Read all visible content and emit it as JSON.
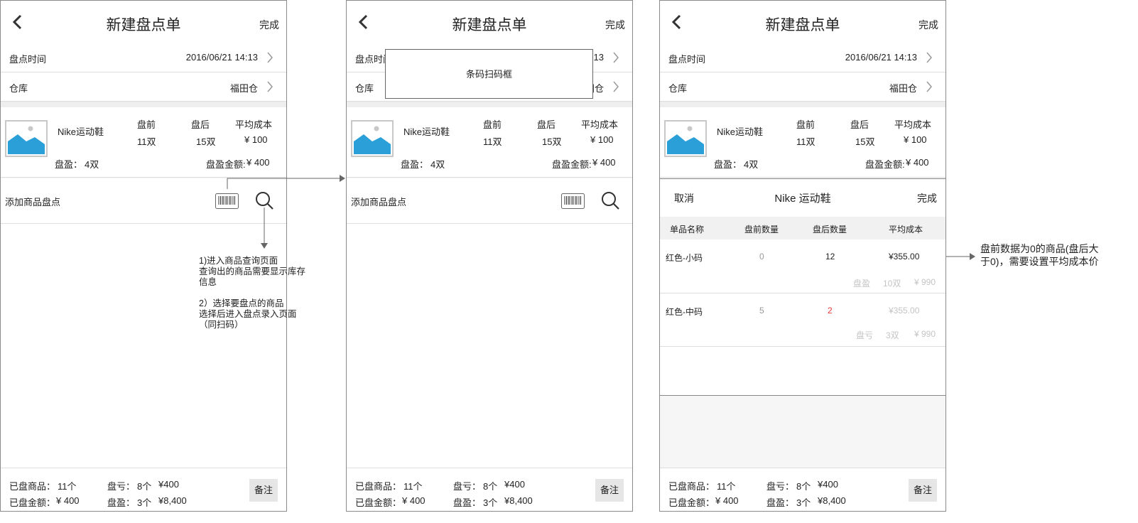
{
  "header": {
    "title": "新建盘点单",
    "done": "完成"
  },
  "time_row": {
    "label": "盘点时间",
    "value": "2016/06/21 14:13",
    "value_cut": "13",
    "label_cut": "盘点时间"
  },
  "warehouse_row": {
    "label": "仓库",
    "value": "福田仓"
  },
  "product": {
    "name": "Nike运动鞋",
    "col_before": "盘前",
    "col_after": "盘后",
    "col_avg": "平均成本",
    "before": "11双",
    "after": "15双",
    "avg": "¥ 100",
    "profit_label": "盘盈：",
    "profit_qty": "4双",
    "profit_amount_label": "盘盈金额:",
    "profit_amount": "¥ 400"
  },
  "add_row": {
    "label": "添加商品盘点"
  },
  "footer": {
    "counted_label": "已盘商品：",
    "counted_value": "11个",
    "amount_label": "已盘金额：",
    "amount_value": "¥ 400",
    "loss_label": "盘亏：",
    "loss_qty": "8个",
    "loss_amount": "¥400",
    "gain_label": "盘盈：",
    "gain_qty": "3个",
    "gain_amount": "¥8,400",
    "note": "备注"
  },
  "scan_box": {
    "label": "条码扫码框"
  },
  "variant_panel": {
    "cancel": "取消",
    "title": "Nike 运动鞋",
    "done": "完成",
    "headers": [
      "单品名称",
      "盘前数量",
      "盘后数量",
      "平均成本"
    ],
    "rows": [
      {
        "name": "红色-小码",
        "before": "0",
        "after": "12",
        "cost": "¥355.00",
        "sub_label": "盘盈",
        "sub_qty": "10双",
        "sub_amount": "¥ 990"
      },
      {
        "name": "红色-中码",
        "before": "5",
        "after": "2",
        "cost": "¥355.00",
        "sub_label": "盘亏",
        "sub_qty": "3双",
        "sub_amount": "¥ 990"
      }
    ]
  },
  "annotations": {
    "search_note": [
      "1)进入商品查询页面",
      "查询出的商品需要显示库存",
      "信息",
      "",
      "2）选择要盘点的商品",
      "选择后进入盘点录入页面",
      "（同扫码）"
    ],
    "cost_note": [
      "盘前数据为0的商品(盘后大",
      "于0)，需要设置平均成本价"
    ]
  },
  "colors": {
    "accent_red": "#e53935",
    "image_blue": "#2a9fd8"
  }
}
